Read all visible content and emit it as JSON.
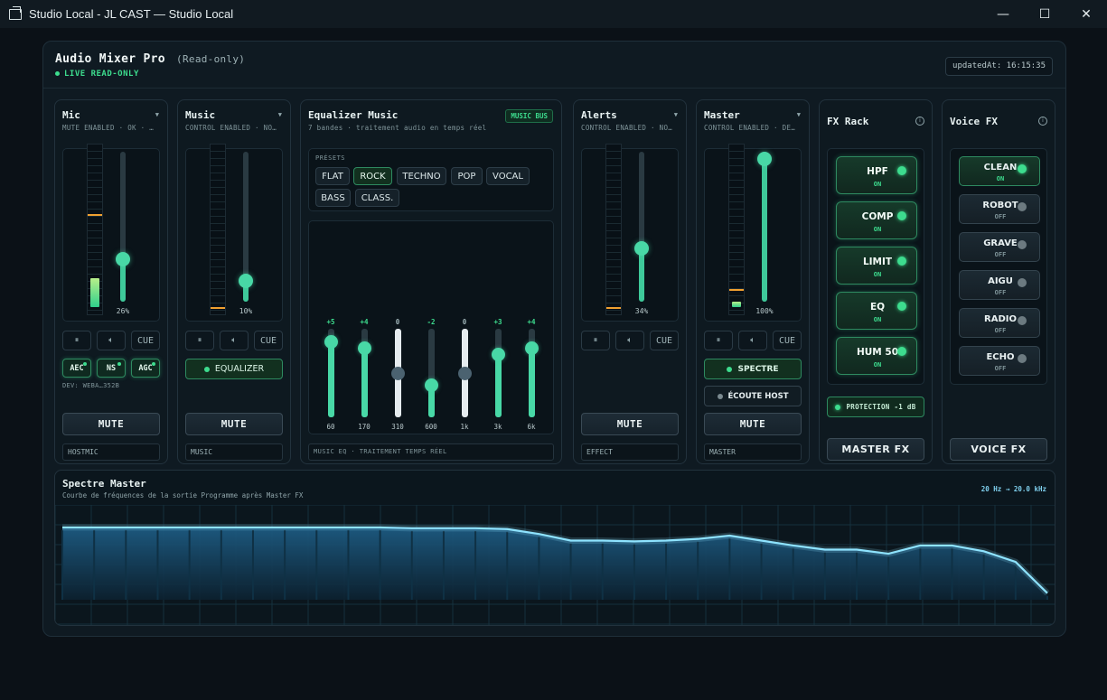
{
  "window": {
    "title": "Studio Local - JL CAST — Studio Local",
    "minimize": "—",
    "maximize": "☐",
    "close": "✕"
  },
  "header": {
    "title": "Audio Mixer Pro",
    "mode": "(Read-only)",
    "live": "LIVE READ-ONLY",
    "updated": "updatedAt: 16:15:35"
  },
  "strips": {
    "mic": {
      "title": "Mic",
      "sub": "MUTE ENABLED · OK · …",
      "level": 26,
      "pct": "26%",
      "meter_peak": 0.58,
      "meter_fill": 0.17,
      "cue": "CUE",
      "fx": [
        "AEC",
        "NS",
        "AGC"
      ],
      "dev": "DEV: WEBA…352B",
      "mute": "MUTE",
      "bus": "HOSTMIC"
    },
    "music": {
      "title": "Music",
      "sub": "CONTROL ENABLED · NO…",
      "level": 10,
      "pct": "10%",
      "cue": "CUE",
      "eq_button": "EQUALIZER",
      "mute": "MUTE",
      "bus": "MUSIC"
    },
    "alerts": {
      "title": "Alerts",
      "sub": "CONTROL ENABLED · NO…",
      "level": 34,
      "pct": "34%",
      "cue": "CUE",
      "mute": "MUTE",
      "bus": "EFFECT"
    },
    "master": {
      "title": "Master",
      "sub": "CONTROL ENABLED · DE…",
      "level": 100,
      "pct": "100%",
      "meter_peak": 0.14,
      "meter_fill": 0.03,
      "cue": "CUE",
      "spectre": "SPECTRE",
      "ecoute": "ÉCOUTE HOST",
      "mute": "MUTE",
      "bus": "MASTER"
    }
  },
  "eq": {
    "title": "Equalizer Music",
    "sub": "7 bandes · traitement audio en temps réel",
    "badge": "MUSIC BUS",
    "presets_label": "PRÉSETS",
    "presets": [
      "FLAT",
      "ROCK",
      "TECHNO",
      "POP",
      "VOCAL",
      "BASS",
      "CLASS."
    ],
    "active_preset": "ROCK",
    "bands": [
      {
        "freq": "60",
        "gain": 5,
        "label": "+5"
      },
      {
        "freq": "170",
        "gain": 4,
        "label": "+4"
      },
      {
        "freq": "310",
        "gain": 0,
        "label": "0"
      },
      {
        "freq": "600",
        "gain": -2,
        "label": "-2"
      },
      {
        "freq": "1k",
        "gain": 0,
        "label": "0"
      },
      {
        "freq": "3k",
        "gain": 3,
        "label": "+3"
      },
      {
        "freq": "6k",
        "gain": 4,
        "label": "+4"
      }
    ],
    "footer": "MUSIC EQ · TRAITEMENT TEMPS RÉEL"
  },
  "fx_rack": {
    "title": "FX Rack",
    "items": [
      {
        "name": "HPF",
        "state": "ON"
      },
      {
        "name": "COMP",
        "state": "ON"
      },
      {
        "name": "LIMIT",
        "state": "ON"
      },
      {
        "name": "EQ",
        "state": "ON"
      },
      {
        "name": "HUM 50",
        "state": "ON"
      }
    ],
    "protection": "PROTECTION -1 dB",
    "button": "MASTER FX"
  },
  "voice_fx": {
    "title": "Voice FX",
    "items": [
      {
        "name": "CLEAN",
        "state": "ON"
      },
      {
        "name": "ROBOT",
        "state": "OFF"
      },
      {
        "name": "GRAVE",
        "state": "OFF"
      },
      {
        "name": "AIGU",
        "state": "OFF"
      },
      {
        "name": "RADIO",
        "state": "OFF"
      },
      {
        "name": "ECHO",
        "state": "OFF"
      }
    ],
    "button": "VOICE FX"
  },
  "spectrum": {
    "title": "Spectre Master",
    "sub": "Courbe de fréquences de la sortie Programme après Master FX",
    "range": "20 Hz → 20.0 kHz",
    "levels": [
      0.88,
      0.88,
      0.88,
      0.88,
      0.88,
      0.88,
      0.88,
      0.88,
      0.88,
      0.88,
      0.88,
      0.87,
      0.87,
      0.87,
      0.86,
      0.8,
      0.72,
      0.72,
      0.71,
      0.72,
      0.74,
      0.78,
      0.72,
      0.66,
      0.61,
      0.61,
      0.56,
      0.66,
      0.66,
      0.59,
      0.46,
      0.08
    ],
    "colors": {
      "line": "#8ee3ff",
      "fill": "#1d5b82"
    }
  },
  "colors": {
    "accent": "#3ddc8e",
    "knob": "#48d8a6",
    "peak": "#f0a030"
  }
}
